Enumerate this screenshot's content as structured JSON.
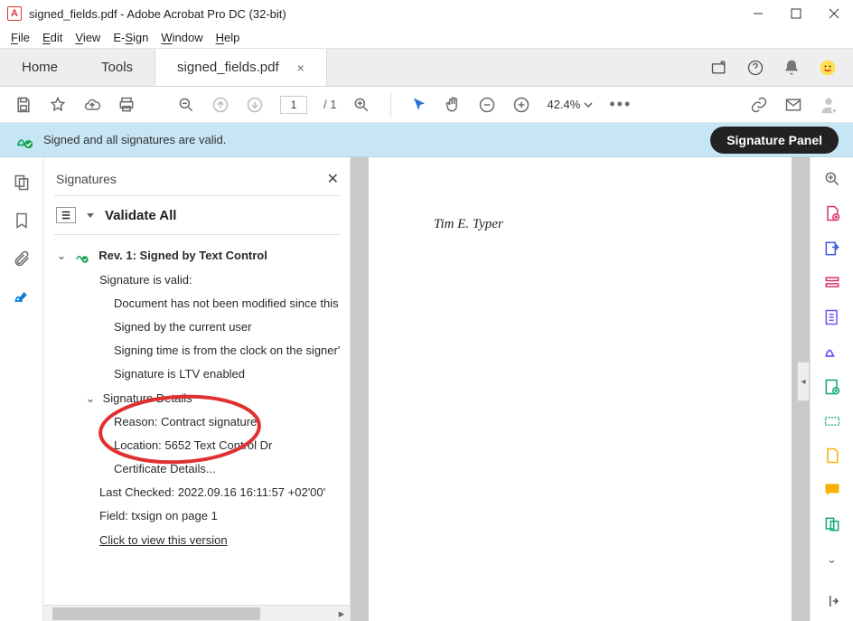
{
  "window": {
    "title": "signed_fields.pdf - Adobe Acrobat Pro DC (32-bit)"
  },
  "menu": {
    "file": "File",
    "edit": "Edit",
    "view": "View",
    "esign": "E-Sign",
    "window": "Window",
    "help": "Help"
  },
  "tabs": {
    "home": "Home",
    "tools": "Tools",
    "doc": "signed_fields.pdf"
  },
  "toolbar": {
    "page_current": "1",
    "page_total": "/ 1",
    "zoom": "42.4%"
  },
  "banner": {
    "message": "Signed and all signatures are valid.",
    "button": "Signature Panel"
  },
  "sig_panel": {
    "title": "Signatures",
    "validate_label": "Validate All",
    "rev_title": "Rev. 1: Signed by Text Control",
    "status_valid": "Signature is valid:",
    "line_notmod": "Document has not been modified since this sig",
    "line_curuser": "Signed by the current user",
    "line_time": "Signing time is from the clock on the signer's c",
    "line_ltv": "Signature is LTV enabled",
    "details_hdr": "Signature Details",
    "reason": "Reason: Contract signature",
    "location": "Location: 5652 Text Control Dr",
    "cert": "Certificate Details...",
    "last_checked": "Last Checked: 2022.09.16 16:11:57 +02'00'",
    "field": "Field: txsign on page 1",
    "view_version": "Click to view this version"
  },
  "document": {
    "signature_text": "Tim E. Typer"
  }
}
